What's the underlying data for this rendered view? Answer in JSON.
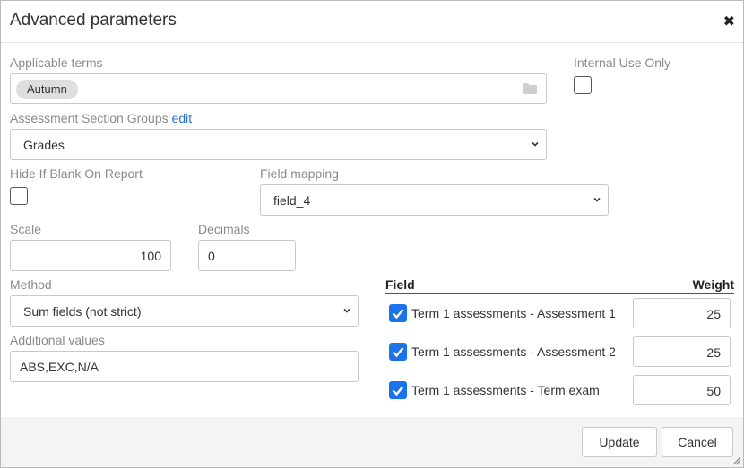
{
  "dialog": {
    "title": "Advanced parameters",
    "close_label": "✖"
  },
  "applicable_terms": {
    "label": "Applicable terms",
    "tags": [
      "Autumn"
    ]
  },
  "internal_use": {
    "label": "Internal Use Only",
    "checked": false
  },
  "section_groups": {
    "label": "Assessment Section Groups",
    "edit_label": "edit",
    "value": "Grades"
  },
  "hide_if_blank": {
    "label": "Hide If Blank On Report",
    "checked": false
  },
  "field_mapping": {
    "label": "Field mapping",
    "value": "field_4"
  },
  "scale": {
    "label": "Scale",
    "value": "100"
  },
  "decimals": {
    "label": "Decimals",
    "value": "0"
  },
  "method": {
    "label": "Method",
    "value": "Sum fields (not strict)"
  },
  "additional_values": {
    "label": "Additional values",
    "value": "ABS,EXC,N/A"
  },
  "fields_table": {
    "header_field": "Field",
    "header_weight": "Weight",
    "rows": [
      {
        "label": "Term 1 assessments - Assessment 1",
        "weight": "25",
        "checked": true
      },
      {
        "label": "Term 1 assessments - Assessment 2",
        "weight": "25",
        "checked": true
      },
      {
        "label": "Term 1 assessments - Term exam",
        "weight": "50",
        "checked": true
      }
    ]
  },
  "footer": {
    "update_label": "Update",
    "cancel_label": "Cancel"
  },
  "colors": {
    "accent": "#1a73e8",
    "link": "#2a6ec9",
    "footer_bg": "#f4f4f4"
  }
}
